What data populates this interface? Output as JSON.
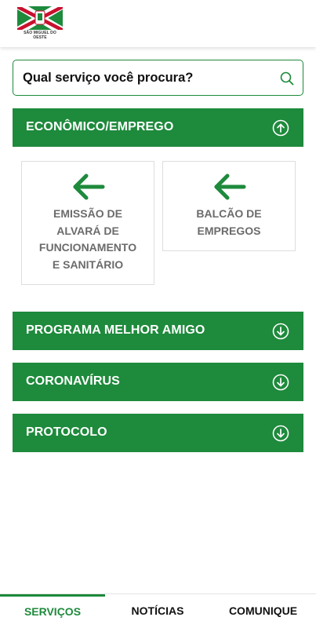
{
  "header": {
    "logo_text": "SÃO MIGUEL DO OESTE"
  },
  "search": {
    "label": "Qual serviço você procura?",
    "icon": "search-icon"
  },
  "colors": {
    "brand_green": "#1e8a3c",
    "card_text": "#6b6b6b",
    "flag_red": "#c8102e"
  },
  "sections": [
    {
      "label": "ECONÔMICO/EMPREGO",
      "state": "expanded",
      "icon": "chevron-up-circle-icon"
    },
    {
      "label": "PROGRAMA MELHOR AMIGO",
      "state": "collapsed",
      "icon": "chevron-down-circle-icon"
    },
    {
      "label": "CORONAVÍRUS",
      "state": "collapsed",
      "icon": "chevron-down-circle-icon"
    },
    {
      "label": "PROTOCOLO",
      "state": "collapsed",
      "icon": "chevron-down-circle-icon"
    }
  ],
  "cards": [
    {
      "lines": [
        "EMISSÃO DE",
        "ALVARÁ DE",
        "FUNCIONAMENTO",
        "E SANITÁRIO"
      ],
      "icon": "arrow-left-icon"
    },
    {
      "lines": [
        "BALCÃO DE",
        "EMPREGOS"
      ],
      "icon": "arrow-left-icon"
    }
  ],
  "bottom_nav": [
    {
      "label": "SERVIÇOS",
      "active": true
    },
    {
      "label": "NOTÍCIAS",
      "active": false
    },
    {
      "label": "COMUNIQUE",
      "active": false
    }
  ]
}
